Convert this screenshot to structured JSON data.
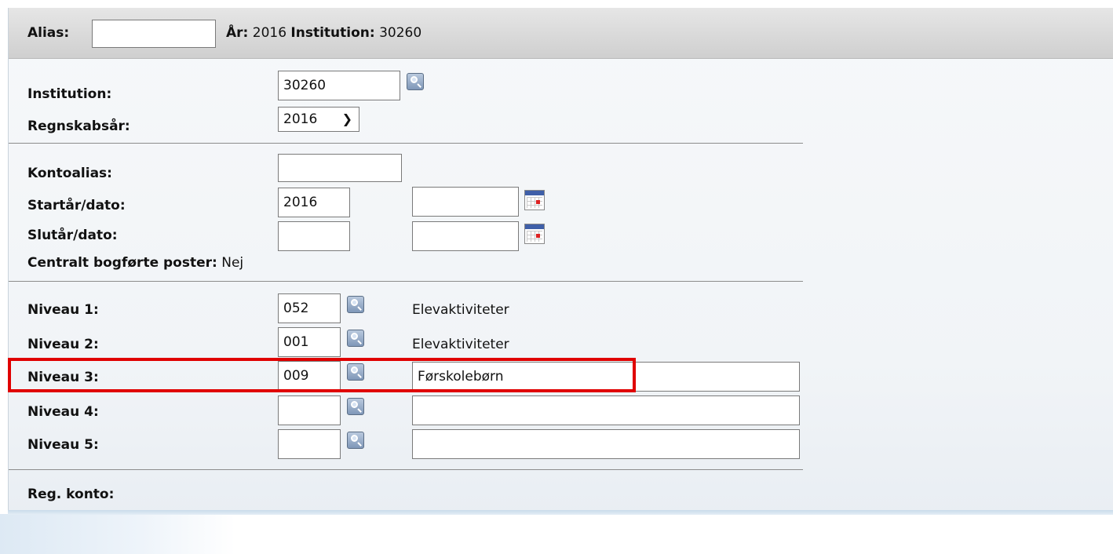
{
  "header": {
    "alias_label": "Alias:",
    "alias_value": "",
    "year_label": "År:",
    "year_value": "2016",
    "institution_label": "Institution:",
    "institution_value": "30260"
  },
  "form": {
    "institution": {
      "label": "Institution:",
      "value": "30260"
    },
    "fiscal_year": {
      "label": "Regnskabsår:",
      "selected": "2016"
    },
    "account_alias": {
      "label": "Kontoalias:",
      "value": ""
    },
    "start": {
      "label": "Startår/dato:",
      "year": "2016",
      "date": ""
    },
    "end": {
      "label": "Slutår/dato:",
      "year": "",
      "date": ""
    },
    "central": {
      "label": "Centralt bogførte poster:",
      "value": "Nej"
    },
    "levels": [
      {
        "label": "Niveau 1:",
        "code": "052",
        "name": "Elevaktiviteter"
      },
      {
        "label": "Niveau 2:",
        "code": "001",
        "name": "Elevaktiviteter"
      },
      {
        "label": "Niveau 3:",
        "code": "009",
        "name": "Førskolebørn"
      },
      {
        "label": "Niveau 4:",
        "code": "",
        "name": ""
      },
      {
        "label": "Niveau 5:",
        "code": "",
        "name": ""
      }
    ],
    "reg_account": {
      "label": "Reg. konto:"
    }
  },
  "colors": {
    "highlight": "#e00000",
    "topbar": "#d6d6d6"
  }
}
